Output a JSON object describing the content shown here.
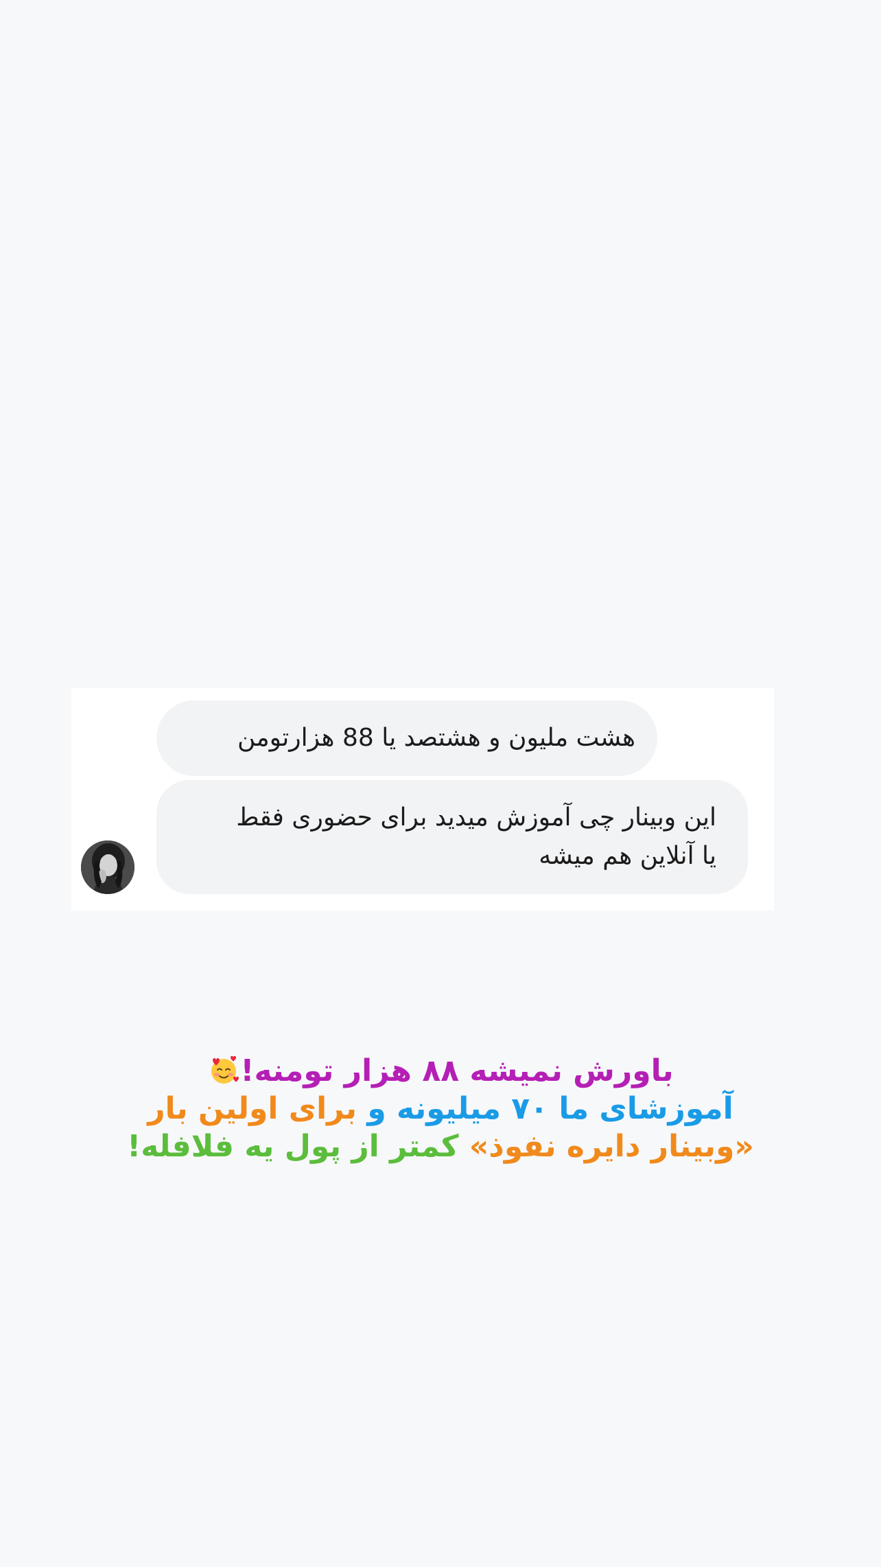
{
  "chat": {
    "messages": [
      {
        "text": "هشت ملیون و هشتصد یا 88 هزارتومن"
      },
      {
        "lines": [
          "این وبینار چی آموزش میدید برای حضوری فقط",
          "یا آنلاین هم میشه"
        ]
      }
    ]
  },
  "caption": {
    "line1": {
      "text": "باورش نمیشه ۸۸ هزار تومنه!",
      "emoji": "smiling-face-with-hearts-icon",
      "color": "#b51fb5"
    },
    "line2": {
      "part1": "آموزشای ما ۷۰ میلیونه و",
      "part1_color": "#1a9be6",
      "part2": "برای اولین بار",
      "part2_color": "#f08a1c"
    },
    "line3": {
      "part1": "«وبینار دایره نفوذ»",
      "part1_color": "#f08a1c",
      "part2": "کمتر از پول یه فلافله!",
      "part2_color": "#5bbd3c"
    }
  },
  "colors": {
    "background": "#f7f8fa",
    "card": "#ffffff",
    "bubble": "#f2f3f5",
    "message_text": "#1b1b1b"
  }
}
